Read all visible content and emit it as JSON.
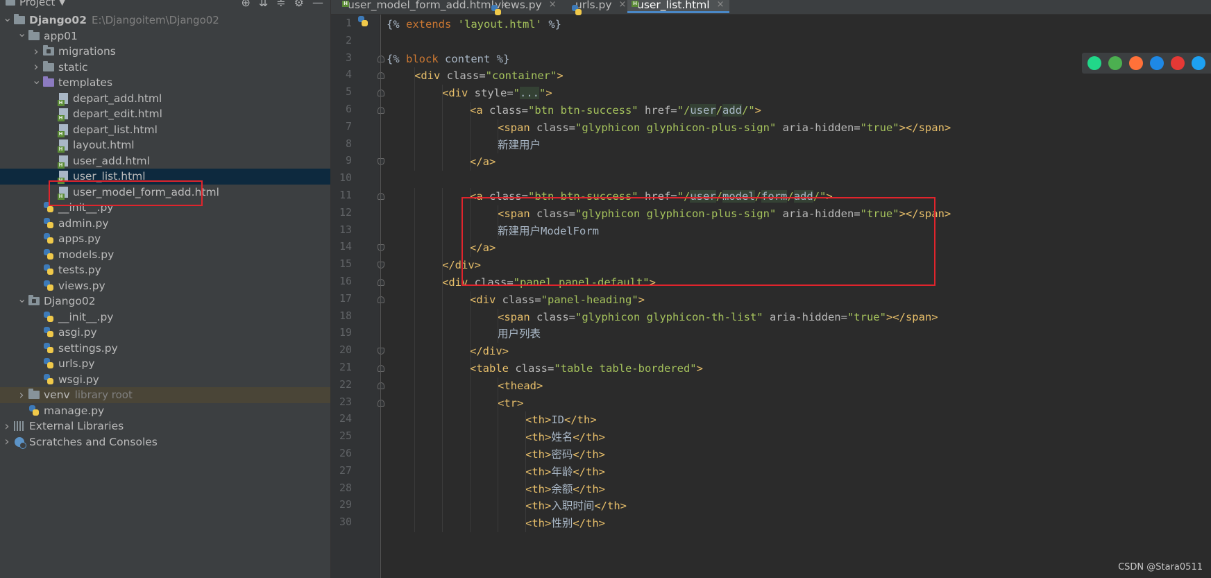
{
  "project_panel": {
    "title": "Project",
    "tree": [
      {
        "indent": 0,
        "arrow": "down",
        "icon": "folder-icon",
        "label": "Django02",
        "bold": true,
        "extra": "E:\\Djangoitem\\Django02"
      },
      {
        "indent": 1,
        "arrow": "down",
        "icon": "folder-icon",
        "label": "app01"
      },
      {
        "indent": 2,
        "arrow": "right",
        "icon": "module-folder-icon",
        "label": "migrations"
      },
      {
        "indent": 2,
        "arrow": "right",
        "icon": "folder-icon",
        "label": "static"
      },
      {
        "indent": 2,
        "arrow": "down",
        "icon": "templates-folder-icon",
        "label": "templates"
      },
      {
        "indent": 3,
        "icon": "html-file-icon",
        "label": "depart_add.html"
      },
      {
        "indent": 3,
        "icon": "html-file-icon",
        "label": "depart_edit.html"
      },
      {
        "indent": 3,
        "icon": "html-file-icon",
        "label": "depart_list.html"
      },
      {
        "indent": 3,
        "icon": "html-file-icon",
        "label": "layout.html"
      },
      {
        "indent": 3,
        "icon": "html-file-icon",
        "label": "user_add.html"
      },
      {
        "indent": 3,
        "icon": "html-file-icon",
        "label": "user_list.html",
        "selected": true
      },
      {
        "indent": 3,
        "icon": "html-file-icon",
        "label": "user_model_form_add.html"
      },
      {
        "indent": 2,
        "icon": "python-file-icon",
        "label": "__init__.py"
      },
      {
        "indent": 2,
        "icon": "python-file-icon",
        "label": "admin.py"
      },
      {
        "indent": 2,
        "icon": "python-file-icon",
        "label": "apps.py"
      },
      {
        "indent": 2,
        "icon": "python-file-icon",
        "label": "models.py"
      },
      {
        "indent": 2,
        "icon": "python-file-icon",
        "label": "tests.py"
      },
      {
        "indent": 2,
        "icon": "python-file-icon",
        "label": "views.py"
      },
      {
        "indent": 1,
        "arrow": "down",
        "icon": "module-folder-icon",
        "label": "Django02"
      },
      {
        "indent": 2,
        "icon": "python-file-icon",
        "label": "__init__.py"
      },
      {
        "indent": 2,
        "icon": "python-file-icon",
        "label": "asgi.py"
      },
      {
        "indent": 2,
        "icon": "python-file-icon",
        "label": "settings.py"
      },
      {
        "indent": 2,
        "icon": "python-file-icon",
        "label": "urls.py"
      },
      {
        "indent": 2,
        "icon": "python-file-icon",
        "label": "wsgi.py"
      },
      {
        "indent": 1,
        "arrow": "right",
        "icon": "folder-icon",
        "label": "venv",
        "extra": "library root",
        "venv": true
      },
      {
        "indent": 1,
        "icon": "python-file-icon",
        "label": "manage.py"
      },
      {
        "indent": 0,
        "arrow": "right",
        "icon": "libraries-icon",
        "label": "External Libraries"
      },
      {
        "indent": 0,
        "arrow": "right",
        "icon": "scratches-icon",
        "label": "Scratches and Consoles"
      }
    ]
  },
  "tabs": [
    {
      "label": "user_model_form_add.html",
      "icon": "html-file-icon"
    },
    {
      "label": "views.py",
      "icon": "python-file-icon"
    },
    {
      "label": "urls.py",
      "icon": "python-file-icon"
    },
    {
      "label": "user_list.html",
      "icon": "html-file-icon",
      "active": true
    }
  ],
  "tab_close": "×",
  "code_lines": [
    {
      "n": "1",
      "indent": 0,
      "segs": [
        [
          "tpl",
          "{% "
        ],
        [
          "kw",
          "extends "
        ],
        [
          "str",
          "'layout.html'"
        ],
        [
          "tpl",
          " %}"
        ]
      ]
    },
    {
      "n": "2",
      "indent": 0,
      "segs": []
    },
    {
      "n": "3",
      "indent": 0,
      "segs": [
        [
          "tpl",
          "{% "
        ],
        [
          "kw",
          "block "
        ],
        [
          "tpl",
          "content %}"
        ]
      ]
    },
    {
      "n": "4",
      "indent": 1,
      "segs": [
        [
          "tag",
          "<div "
        ],
        [
          "attr",
          "class="
        ],
        [
          "str",
          "\"container\""
        ],
        [
          "tag",
          ">"
        ]
      ]
    },
    {
      "n": "5",
      "indent": 2,
      "segs": [
        [
          "tag",
          "<div "
        ],
        [
          "attr",
          "style="
        ],
        [
          "str",
          "\""
        ],
        [
          "hl",
          "..."
        ],
        [
          "str",
          "\""
        ],
        [
          "tag",
          ">"
        ]
      ]
    },
    {
      "n": "6",
      "indent": 3,
      "segs": [
        [
          "tag",
          "<a "
        ],
        [
          "attr",
          "class="
        ],
        [
          "str",
          "\"btn btn-success\" "
        ],
        [
          "attr",
          "href="
        ],
        [
          "str",
          "\"/"
        ],
        [
          "hl",
          "user"
        ],
        [
          "str",
          "/"
        ],
        [
          "hl",
          "add"
        ],
        [
          "str",
          "/\""
        ],
        [
          "tag",
          ">"
        ]
      ]
    },
    {
      "n": "7",
      "indent": 4,
      "segs": [
        [
          "tag",
          "<span "
        ],
        [
          "attr",
          "class="
        ],
        [
          "str",
          "\"glyphicon glyphicon-plus-sign\" "
        ],
        [
          "attr",
          "aria-hidden="
        ],
        [
          "str",
          "\"true\""
        ],
        [
          "tag",
          "></span>"
        ]
      ]
    },
    {
      "n": "8",
      "indent": 4,
      "segs": [
        [
          "cn",
          "新建用户"
        ]
      ]
    },
    {
      "n": "9",
      "indent": 3,
      "segs": [
        [
          "tag",
          "</a>"
        ]
      ]
    },
    {
      "n": "10",
      "indent": 0,
      "segs": []
    },
    {
      "n": "11",
      "indent": 3,
      "segs": [
        [
          "tag",
          "<a "
        ],
        [
          "attr",
          "class="
        ],
        [
          "str",
          "\"btn btn-success\" "
        ],
        [
          "attr",
          "href="
        ],
        [
          "str",
          "\"/"
        ],
        [
          "hl",
          "user"
        ],
        [
          "str",
          "/"
        ],
        [
          "hl",
          "model"
        ],
        [
          "str",
          "/"
        ],
        [
          "hl",
          "form"
        ],
        [
          "str",
          "/"
        ],
        [
          "hl",
          "add"
        ],
        [
          "str",
          "/\""
        ],
        [
          "tag",
          ">"
        ]
      ]
    },
    {
      "n": "12",
      "indent": 4,
      "segs": [
        [
          "tag",
          "<span "
        ],
        [
          "attr",
          "class="
        ],
        [
          "str",
          "\"glyphicon glyphicon-plus-sign\" "
        ],
        [
          "attr",
          "aria-hidden="
        ],
        [
          "str",
          "\"true\""
        ],
        [
          "tag",
          "></span>"
        ]
      ]
    },
    {
      "n": "13",
      "indent": 4,
      "segs": [
        [
          "cn",
          "新建用户ModelForm"
        ]
      ]
    },
    {
      "n": "14",
      "indent": 3,
      "segs": [
        [
          "tag",
          "</a>"
        ]
      ]
    },
    {
      "n": "15",
      "indent": 2,
      "segs": [
        [
          "tag",
          "</div>"
        ]
      ]
    },
    {
      "n": "16",
      "indent": 2,
      "segs": [
        [
          "tag",
          "<div "
        ],
        [
          "attr",
          "class="
        ],
        [
          "str",
          "\"panel panel-default\""
        ],
        [
          "tag",
          ">"
        ]
      ]
    },
    {
      "n": "17",
      "indent": 3,
      "segs": [
        [
          "tag",
          "<div "
        ],
        [
          "attr",
          "class="
        ],
        [
          "str",
          "\"panel-heading\""
        ],
        [
          "tag",
          ">"
        ]
      ]
    },
    {
      "n": "18",
      "indent": 4,
      "segs": [
        [
          "tag",
          "<span "
        ],
        [
          "attr",
          "class="
        ],
        [
          "str",
          "\"glyphicon glyphicon-th-list\" "
        ],
        [
          "attr",
          "aria-hidden="
        ],
        [
          "str",
          "\"true\""
        ],
        [
          "tag",
          "></span>"
        ]
      ]
    },
    {
      "n": "19",
      "indent": 4,
      "segs": [
        [
          "cn",
          "用户列表"
        ]
      ]
    },
    {
      "n": "20",
      "indent": 3,
      "segs": [
        [
          "tag",
          "</div>"
        ]
      ]
    },
    {
      "n": "21",
      "indent": 3,
      "segs": [
        [
          "tag",
          "<table "
        ],
        [
          "attr",
          "class="
        ],
        [
          "str",
          "\"table table-bordered\""
        ],
        [
          "tag",
          ">"
        ]
      ]
    },
    {
      "n": "22",
      "indent": 4,
      "segs": [
        [
          "tag",
          "<thead>"
        ]
      ]
    },
    {
      "n": "23",
      "indent": 4,
      "segs": [
        [
          "tag",
          "<tr>"
        ]
      ]
    },
    {
      "n": "24",
      "indent": 5,
      "segs": [
        [
          "tag",
          "<th>"
        ],
        [
          "cn",
          "ID"
        ],
        [
          "tag",
          "</th>"
        ]
      ]
    },
    {
      "n": "25",
      "indent": 5,
      "segs": [
        [
          "tag",
          "<th>"
        ],
        [
          "cn",
          "姓名"
        ],
        [
          "tag",
          "</th>"
        ]
      ]
    },
    {
      "n": "26",
      "indent": 5,
      "segs": [
        [
          "tag",
          "<th>"
        ],
        [
          "cn",
          "密码"
        ],
        [
          "tag",
          "</th>"
        ]
      ]
    },
    {
      "n": "27",
      "indent": 5,
      "segs": [
        [
          "tag",
          "<th>"
        ],
        [
          "cn",
          "年龄"
        ],
        [
          "tag",
          "</th>"
        ]
      ]
    },
    {
      "n": "28",
      "indent": 5,
      "segs": [
        [
          "tag",
          "<th>"
        ],
        [
          "cn",
          "余额"
        ],
        [
          "tag",
          "</th>"
        ]
      ]
    },
    {
      "n": "29",
      "indent": 5,
      "segs": [
        [
          "tag",
          "<th>"
        ],
        [
          "cn",
          "入职时间"
        ],
        [
          "tag",
          "</th>"
        ]
      ]
    },
    {
      "n": "30",
      "indent": 5,
      "segs": [
        [
          "tag",
          "<th>"
        ],
        [
          "cn",
          "性别"
        ],
        [
          "tag",
          "</th>"
        ]
      ]
    }
  ],
  "browser_icons": [
    "pycharm-icon",
    "chrome-icon",
    "firefox-icon",
    "safari-icon",
    "opera-icon",
    "edge-icon"
  ],
  "browser_colors": [
    "#21d789",
    "#4caf50",
    "#ff7139",
    "#1e88e5",
    "#e53935",
    "#1da1f2"
  ],
  "watermark": "CSDN @Stara0511"
}
